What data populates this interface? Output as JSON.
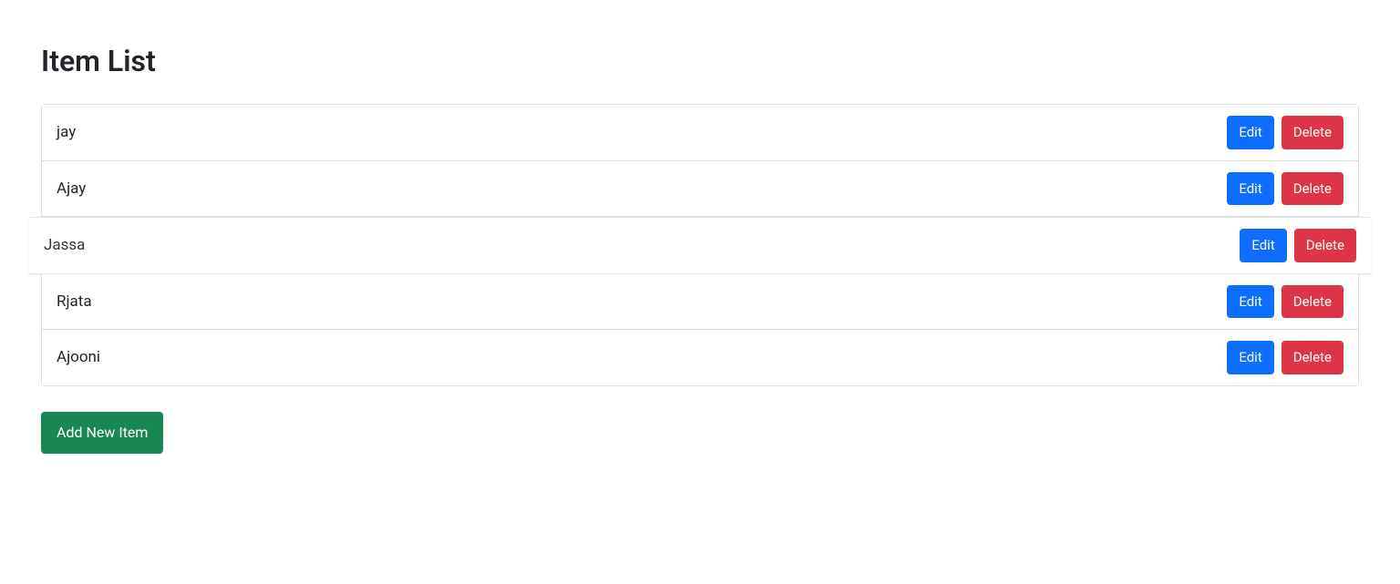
{
  "title": "Item List",
  "items": [
    {
      "name": "jay"
    },
    {
      "name": "Ajay"
    },
    {
      "name": "Jassa"
    },
    {
      "name": "Rjata"
    },
    {
      "name": "Ajooni"
    }
  ],
  "buttons": {
    "edit": "Edit",
    "delete": "Delete",
    "add": "Add New Item"
  },
  "hoveredIndex": 2
}
